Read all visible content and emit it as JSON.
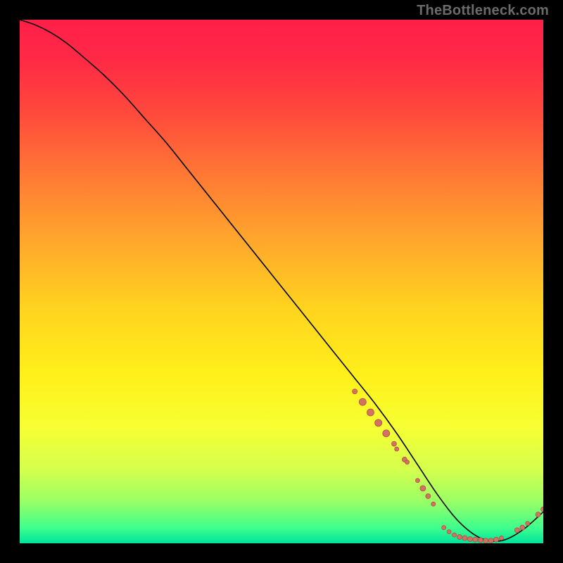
{
  "watermark": "TheBottleneck.com",
  "colors": {
    "background": "#000000",
    "watermark_text": "#6b6b6b",
    "curve": "#000000",
    "marker_fill": "#d27264",
    "marker_stroke": "#b34f43",
    "gradient_stops": [
      {
        "offset": 0.0,
        "color": "#ff1f4a"
      },
      {
        "offset": 0.08,
        "color": "#ff2a45"
      },
      {
        "offset": 0.18,
        "color": "#ff4a3c"
      },
      {
        "offset": 0.3,
        "color": "#ff7a34"
      },
      {
        "offset": 0.42,
        "color": "#ffa62c"
      },
      {
        "offset": 0.55,
        "color": "#ffd31f"
      },
      {
        "offset": 0.68,
        "color": "#fff01a"
      },
      {
        "offset": 0.78,
        "color": "#f5ff33"
      },
      {
        "offset": 0.86,
        "color": "#d4ff4d"
      },
      {
        "offset": 0.92,
        "color": "#9aff66"
      },
      {
        "offset": 0.97,
        "color": "#3fff8c"
      },
      {
        "offset": 1.0,
        "color": "#00e49d"
      }
    ]
  },
  "chart_data": {
    "type": "line",
    "title": "",
    "xlabel": "",
    "ylabel": "",
    "xlim": [
      0,
      100
    ],
    "ylim": [
      0,
      100
    ],
    "grid": false,
    "series": [
      {
        "name": "bottleneck-curve",
        "x": [
          0,
          3,
          6,
          9,
          12,
          16,
          20,
          24,
          28,
          32,
          36,
          40,
          44,
          48,
          52,
          56,
          60,
          64,
          68,
          72,
          76,
          80,
          84,
          88,
          92,
          96,
          100
        ],
        "y": [
          100,
          99,
          97.5,
          95.5,
          93,
          89.5,
          85.5,
          81,
          76.5,
          71.5,
          66.5,
          61.5,
          56.5,
          51.5,
          46.5,
          41.5,
          36.5,
          31.5,
          26.5,
          21,
          15,
          9,
          4,
          1,
          0.5,
          2.5,
          6
        ]
      }
    ],
    "markers": {
      "name": "bottleneck-points",
      "points": [
        {
          "x": 64.0,
          "y": 29.0,
          "r": 3.5
        },
        {
          "x": 65.5,
          "y": 27.0,
          "r": 5.0
        },
        {
          "x": 67.0,
          "y": 25.0,
          "r": 5.0
        },
        {
          "x": 68.5,
          "y": 23.0,
          "r": 5.0
        },
        {
          "x": 70.0,
          "y": 21.0,
          "r": 5.0
        },
        {
          "x": 71.5,
          "y": 19.0,
          "r": 3.5
        },
        {
          "x": 72.0,
          "y": 18.0,
          "r": 3.0
        },
        {
          "x": 73.5,
          "y": 16.0,
          "r": 3.5
        },
        {
          "x": 74.0,
          "y": 15.5,
          "r": 3.0
        },
        {
          "x": 76.0,
          "y": 12.0,
          "r": 3.0
        },
        {
          "x": 77.0,
          "y": 10.5,
          "r": 4.0
        },
        {
          "x": 78.0,
          "y": 9.0,
          "r": 3.5
        },
        {
          "x": 79.0,
          "y": 7.5,
          "r": 3.0
        },
        {
          "x": 81.0,
          "y": 3.0,
          "r": 3.0
        },
        {
          "x": 82.0,
          "y": 2.2,
          "r": 3.0
        },
        {
          "x": 83.0,
          "y": 1.6,
          "r": 3.0
        },
        {
          "x": 84.0,
          "y": 1.2,
          "r": 3.5
        },
        {
          "x": 85.0,
          "y": 1.0,
          "r": 3.5
        },
        {
          "x": 86.0,
          "y": 0.8,
          "r": 3.5
        },
        {
          "x": 87.0,
          "y": 0.7,
          "r": 3.5
        },
        {
          "x": 88.0,
          "y": 0.6,
          "r": 3.5
        },
        {
          "x": 89.0,
          "y": 0.5,
          "r": 3.5
        },
        {
          "x": 90.0,
          "y": 0.5,
          "r": 3.5
        },
        {
          "x": 91.0,
          "y": 0.7,
          "r": 3.5
        },
        {
          "x": 92.0,
          "y": 1.0,
          "r": 3.0
        },
        {
          "x": 95.0,
          "y": 2.5,
          "r": 3.5
        },
        {
          "x": 96.0,
          "y": 3.0,
          "r": 3.5
        },
        {
          "x": 97.0,
          "y": 3.8,
          "r": 3.0
        },
        {
          "x": 99.0,
          "y": 5.5,
          "r": 3.5
        },
        {
          "x": 100.0,
          "y": 6.5,
          "r": 3.5
        }
      ]
    }
  }
}
